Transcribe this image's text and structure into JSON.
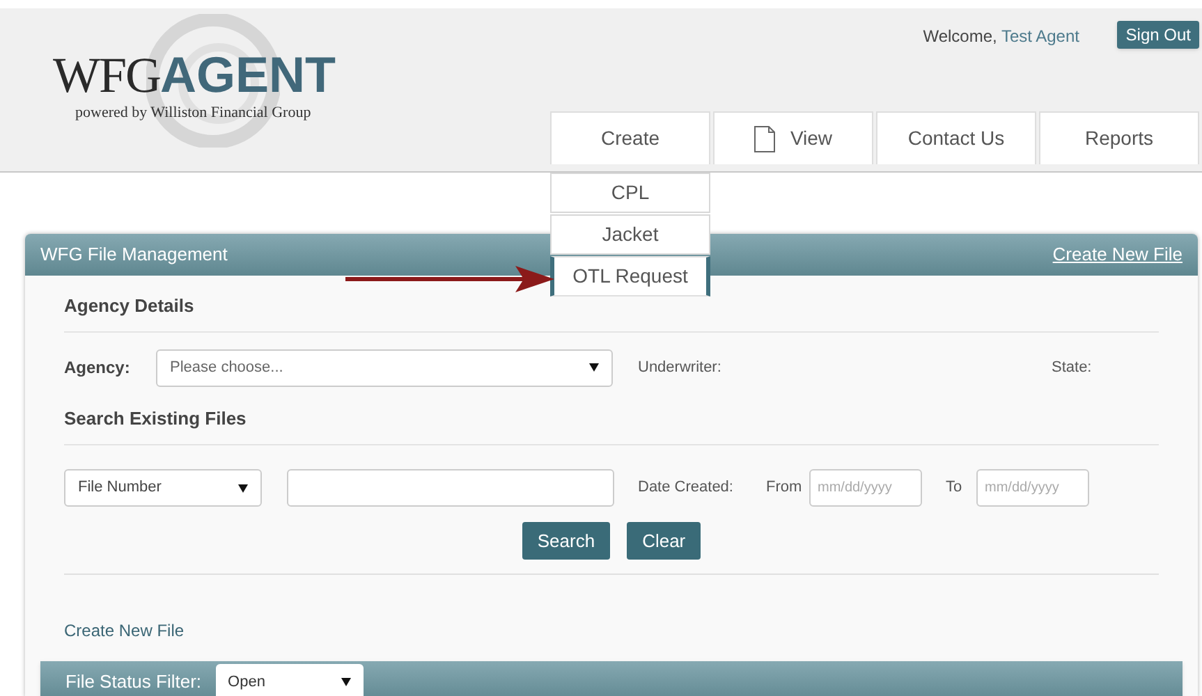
{
  "logo": {
    "brand": "WFG",
    "product": "AGENT",
    "tagline": "powered by Williston Financial Group"
  },
  "header": {
    "welcome": "Welcome,",
    "user": "Test Agent",
    "sign_out": "Sign Out"
  },
  "nav": [
    {
      "label": "Create",
      "icon": false
    },
    {
      "label": "View",
      "icon": true
    },
    {
      "label": "Contact Us",
      "icon": false
    },
    {
      "label": "Reports",
      "icon": false
    }
  ],
  "create_menu": [
    {
      "label": "CPL",
      "highlighted": false
    },
    {
      "label": "Jacket",
      "highlighted": false
    },
    {
      "label": "OTL Request",
      "highlighted": true
    }
  ],
  "panel": {
    "title": "WFG File Management",
    "create_link": "Create New File",
    "agency_details": {
      "heading": "Agency Details",
      "agency_label": "Agency:",
      "agency_value": "Please choose...",
      "underwriter_label": "Underwriter:",
      "state_label": "State:"
    },
    "search": {
      "heading": "Search Existing Files",
      "type_value": "File Number",
      "date_label": "Date Created:",
      "from_label": "From",
      "from_placeholder": "mm/dd/yyyy",
      "to_label": "To",
      "to_placeholder": "mm/dd/yyyy",
      "search_button": "Search",
      "clear_button": "Clear"
    },
    "create_new_file": "Create New File",
    "filter": {
      "label": "File Status Filter:",
      "value": "Open"
    }
  }
}
